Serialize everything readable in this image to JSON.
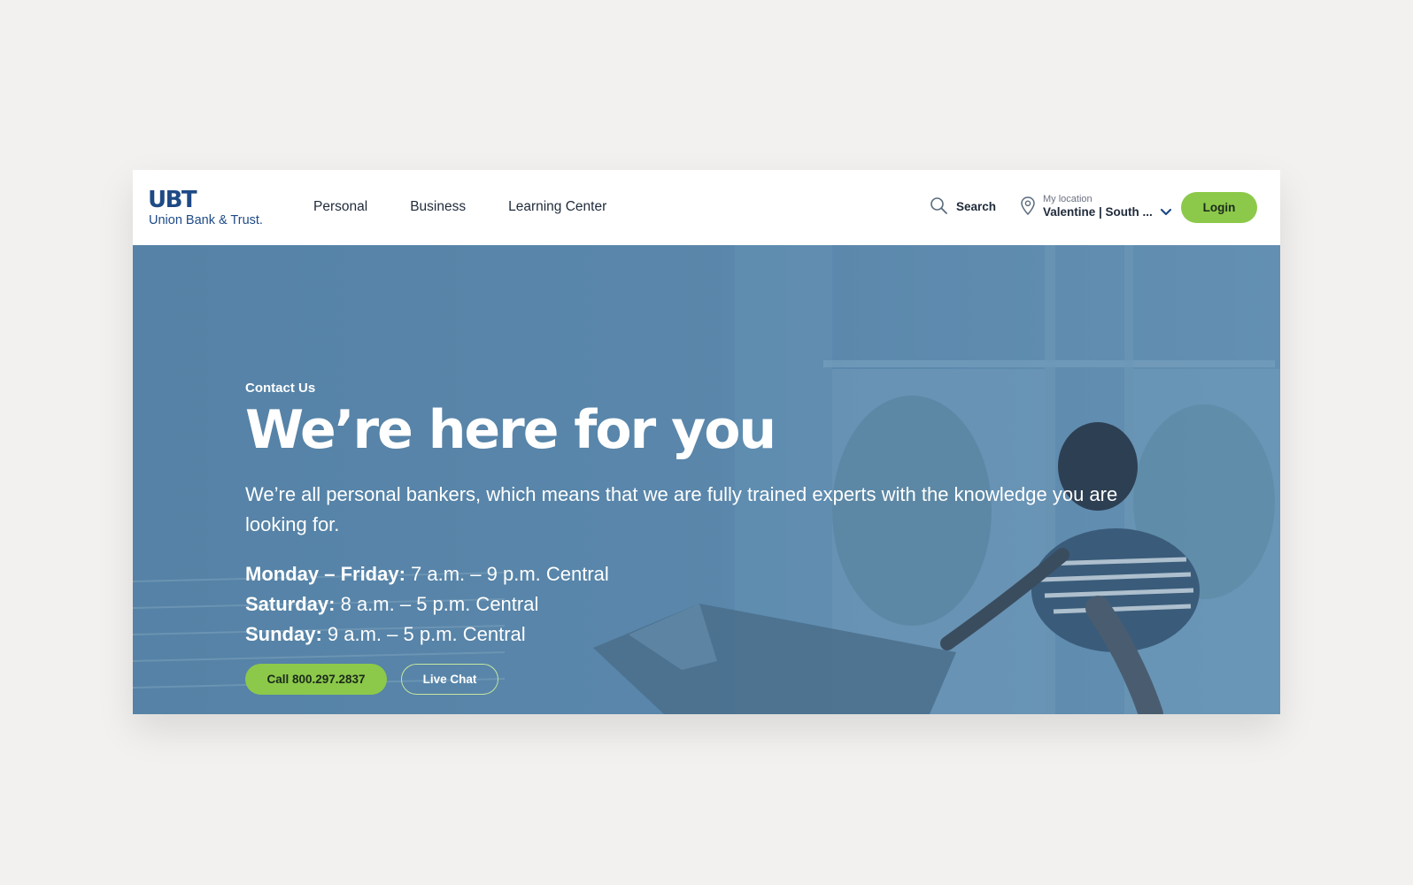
{
  "brand": {
    "logo_mark": "UBT",
    "logo_name": "Union Bank & Trust.",
    "primary_color": "#1e4a86",
    "accent_color": "#8cc94a"
  },
  "header": {
    "nav": [
      "Personal",
      "Business",
      "Learning Center"
    ],
    "search_label": "Search",
    "search_icon": "search-icon",
    "location_caption": "My location",
    "location_value": "Valentine | South ...",
    "location_icon": "map-pin-icon",
    "location_chevron": "chevron-down-icon",
    "login_label": "Login"
  },
  "hero": {
    "eyebrow": "Contact Us",
    "headline": "We’re here for you",
    "description": "We’re all personal bankers, which means that we are fully trained experts with the knowledge you are looking for.",
    "hours": [
      {
        "day": "Monday – Friday:",
        "time": " 7 a.m. – 9 p.m. Central"
      },
      {
        "day": "Saturday:",
        "time": " 8 a.m. – 5 p.m. Central"
      },
      {
        "day": "Sunday:",
        "time": " 9 a.m. – 5 p.m. Central"
      }
    ],
    "call_label": "Call 800.297.2837",
    "chat_label": "Live Chat"
  }
}
